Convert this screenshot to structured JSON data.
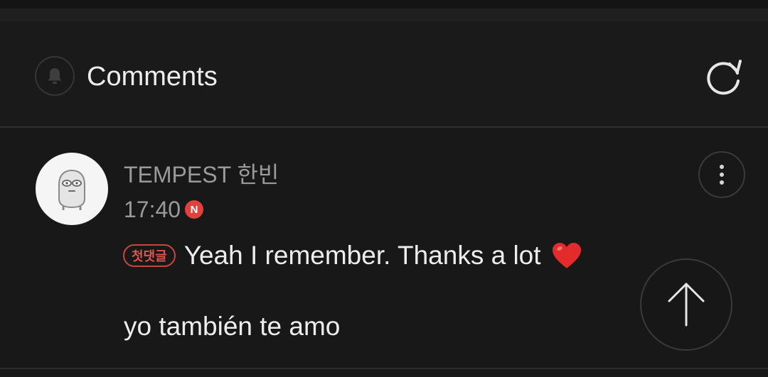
{
  "header": {
    "title": "Comments",
    "bell_icon": "bell-icon",
    "refresh_icon": "refresh-icon"
  },
  "comment": {
    "author": "TEMPEST 한빈",
    "time": "17:40",
    "new_badge": "N",
    "first_comment_tag": "첫댓글",
    "line1": "Yeah I remember. Thanks a lot",
    "line2": "yo también te amo",
    "heart_icon": "heart-emoji-icon",
    "avatar_icon": "cartoon-character-avatar"
  },
  "colors": {
    "background": "#181818",
    "text_primary": "#ededed",
    "text_secondary": "#9a9a9a",
    "accent_red": "#e1413c"
  },
  "floating": {
    "scroll_top_icon": "arrow-up-icon"
  }
}
